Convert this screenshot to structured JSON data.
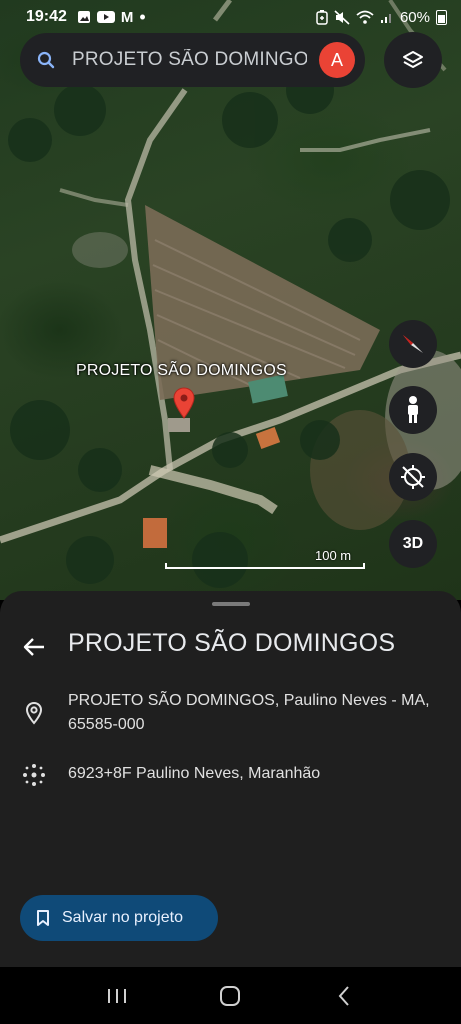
{
  "status_bar": {
    "time": "19:42",
    "left_icons": [
      "gallery-icon",
      "youtube-icon",
      "gmail-icon",
      "dot-icon"
    ],
    "gmail_glyph": "M",
    "right_icons": [
      "battery-saver-icon",
      "mute-icon",
      "wifi-icon",
      "signal-icon"
    ],
    "battery_percent": "60%"
  },
  "search": {
    "query": "PROJETO SÃO DOMINGOS",
    "avatar_letter": "A",
    "avatar_color": "#ea4335"
  },
  "map": {
    "place_label": "PROJETO SÃO DOMINGOS",
    "pin_color": "#ea4335",
    "scale_label": "100 m",
    "controls": [
      "compass-icon",
      "street-view-icon",
      "location-icon",
      "3d"
    ],
    "btn_3d_label": "3D"
  },
  "sheet": {
    "title": "PROJETO SÃO DOMINGOS",
    "address": "PROJETO SÃO DOMINGOS, Paulino Neves - MA, 65585-000",
    "plus_code": "6923+8F Paulino Neves, Maranhão",
    "save_button_label": "Salvar no projeto",
    "accent": "#0f4a78"
  },
  "navbar": {
    "items": [
      "recent-apps-icon",
      "home-icon",
      "back-nav-icon"
    ]
  }
}
